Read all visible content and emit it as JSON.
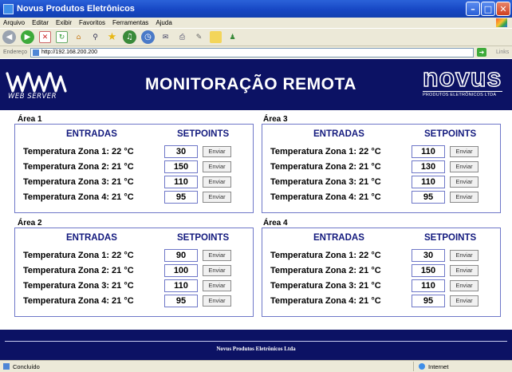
{
  "window": {
    "title": "Novus Produtos Eletrônicos"
  },
  "menu": [
    "Arquivo",
    "Editar",
    "Exibir",
    "Favoritos",
    "Ferramentas",
    "Ajuda"
  ],
  "address": {
    "label": "Endereço",
    "url": "http://192.168.200.200",
    "links": "Links"
  },
  "header": {
    "logo_text": "WEB SERVER",
    "title": "MONITORAÇÃO REMOTA",
    "brand": "novus",
    "brand_sub": "PRODUTOS ELETRÔNICOS LTDA"
  },
  "columns": {
    "inputs": "ENTRADAS",
    "setpoints": "SETPOINTS"
  },
  "button_label": "Enviar",
  "areas": [
    {
      "label": "Área 1",
      "rows": [
        {
          "input": "Temperatura Zona 1: 22 °C",
          "setpoint": "30"
        },
        {
          "input": "Temperatura Zona 2: 21 °C",
          "setpoint": "150"
        },
        {
          "input": "Temperatura Zona 3: 21 °C",
          "setpoint": "110"
        },
        {
          "input": "Temperatura Zona 4: 21 °C",
          "setpoint": "95"
        }
      ]
    },
    {
      "label": "Área 3",
      "rows": [
        {
          "input": "Temperatura Zona 1: 22 °C",
          "setpoint": "110"
        },
        {
          "input": "Temperatura Zona 2: 21 °C",
          "setpoint": "130"
        },
        {
          "input": "Temperatura Zona 3: 21 °C",
          "setpoint": "110"
        },
        {
          "input": "Temperatura Zona 4: 21 °C",
          "setpoint": "95"
        }
      ]
    },
    {
      "label": "Área 2",
      "rows": [
        {
          "input": "Temperatura Zona 1: 22 °C",
          "setpoint": "90"
        },
        {
          "input": "Temperatura Zona 2: 21 °C",
          "setpoint": "100"
        },
        {
          "input": "Temperatura Zona 3: 21 °C",
          "setpoint": "110"
        },
        {
          "input": "Temperatura Zona 4: 21 °C",
          "setpoint": "95"
        }
      ]
    },
    {
      "label": "Área 4",
      "rows": [
        {
          "input": "Temperatura Zona 1: 22 °C",
          "setpoint": "30"
        },
        {
          "input": "Temperatura Zona 2: 21 °C",
          "setpoint": "150"
        },
        {
          "input": "Temperatura Zona 3: 21 °C",
          "setpoint": "110"
        },
        {
          "input": "Temperatura Zona 4: 21 °C",
          "setpoint": "95"
        }
      ]
    }
  ],
  "footer": {
    "text": "Novus Produtos Eletrônicos Ltda"
  },
  "status": {
    "left": "Concluído",
    "zone": "Internet"
  },
  "colors": {
    "header_bg": "#0c1264",
    "heading_text": "#131a7e",
    "box_border": "#6e77c8"
  }
}
